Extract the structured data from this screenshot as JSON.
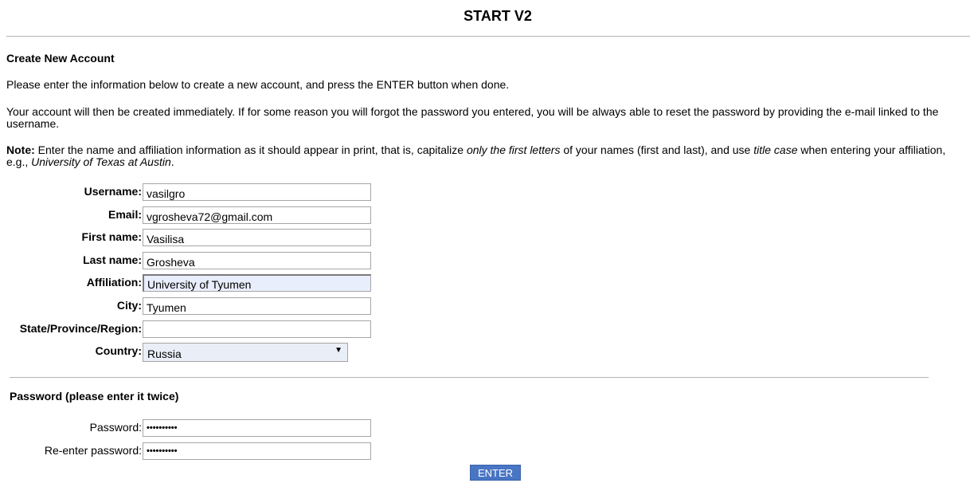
{
  "header": {
    "title": "START V2"
  },
  "create_account": {
    "title": "Create New Account",
    "intro_1": "Please enter the information below to create a new account, and press the ENTER button when done.",
    "intro_2": "Your account will then be created immediately. If for some reason you will forgot the password you entered, you will be always able to reset the password by providing the e-mail linked to the username.",
    "note_label": "Note:",
    "note_text_a": " Enter the name and affiliation information as it should appear in print, that is, capitalize ",
    "note_italic_a": "only the first letters",
    "note_text_b": " of your names (first and last), and use ",
    "note_italic_b": "title case",
    "note_text_c": " when entering your affiliation, e.g., ",
    "note_italic_c": "University of Texas at Austin",
    "note_text_d": "."
  },
  "fields": {
    "username": {
      "label": "Username:",
      "value": "vasilgro"
    },
    "email": {
      "label": "Email:",
      "value": "vgrosheva72@gmail.com"
    },
    "first_name": {
      "label": "First name:",
      "value": "Vasilisa"
    },
    "last_name": {
      "label": "Last name:",
      "value": "Grosheva"
    },
    "affiliation": {
      "label": "Affiliation:",
      "value": "University of Tyumen"
    },
    "city": {
      "label": "City:",
      "value": "Tyumen"
    },
    "state": {
      "label": "State/Province/Region:",
      "value": ""
    },
    "country": {
      "label": "Country:",
      "value": "Russia"
    }
  },
  "password_section": {
    "title": "Password (please enter it twice)",
    "password": {
      "label": "Password:",
      "value": "••••••••••"
    },
    "reenter": {
      "label": "Re-enter password:",
      "value": "••••••••••"
    }
  },
  "actions": {
    "enter_label": "ENTER"
  },
  "colors": {
    "button_bg": "#4875c4",
    "autofill_bg": "#e8eefb",
    "rule": "#b4b4b4"
  }
}
